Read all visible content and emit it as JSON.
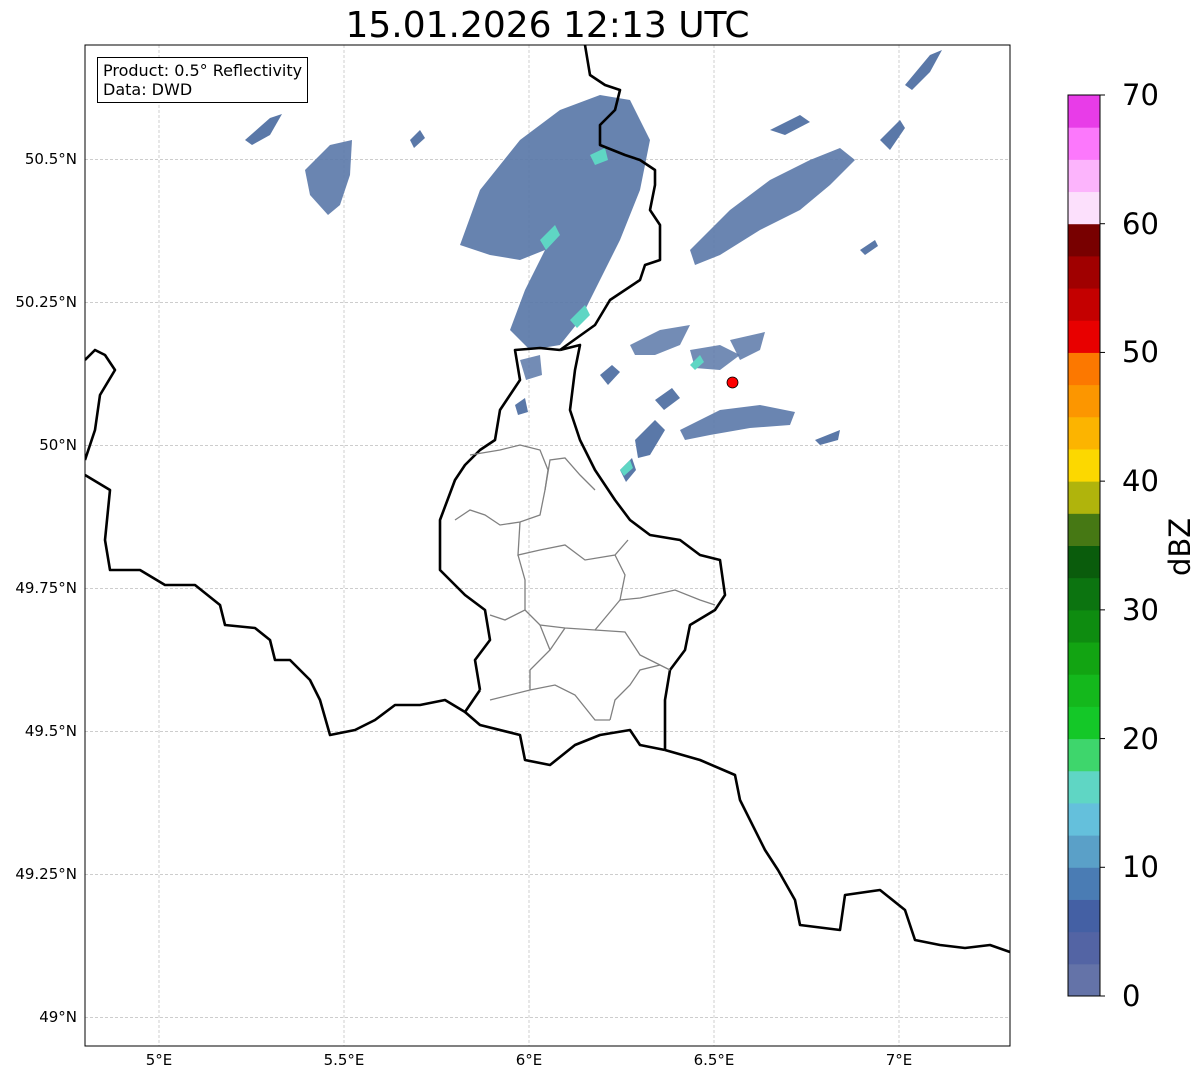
{
  "title": "15.01.2026 12:13 UTC",
  "info": {
    "product": "Product: 0.5° Reflectivity",
    "data": "Data: DWD"
  },
  "axes": {
    "lon_ticks": [
      {
        "value": 5.0,
        "label": "5°E"
      },
      {
        "value": 5.5,
        "label": "5.5°E"
      },
      {
        "value": 6.0,
        "label": "6°E"
      },
      {
        "value": 6.5,
        "label": "6.5°E"
      },
      {
        "value": 7.0,
        "label": "7°E"
      }
    ],
    "lat_ticks": [
      {
        "value": 50.5,
        "label": "50.5°N"
      },
      {
        "value": 50.25,
        "label": "50.25°N"
      },
      {
        "value": 50.0,
        "label": "50°N"
      },
      {
        "value": 49.75,
        "label": "49.75°N"
      },
      {
        "value": 49.5,
        "label": "49.5°N"
      },
      {
        "value": 49.25,
        "label": "49.25°N"
      },
      {
        "value": 49.0,
        "label": "49°N"
      }
    ],
    "lon_range": [
      4.8,
      7.3
    ],
    "lat_range": [
      48.95,
      50.7
    ],
    "grid": true
  },
  "colorbar": {
    "label": "dBZ",
    "min": 0,
    "max": 70,
    "step": 2.5,
    "ticks": [
      {
        "value": 0,
        "label": "0"
      },
      {
        "value": 10,
        "label": "10"
      },
      {
        "value": 20,
        "label": "20"
      },
      {
        "value": 30,
        "label": "30"
      },
      {
        "value": 40,
        "label": "40"
      },
      {
        "value": 50,
        "label": "50"
      },
      {
        "value": 60,
        "label": "60"
      },
      {
        "value": 70,
        "label": "70"
      }
    ],
    "colors": [
      "#6473a8",
      "#5364a4",
      "#4460a4",
      "#4a7cb4",
      "#5aa0c8",
      "#64c0dc",
      "#5fd6c4",
      "#3ed66c",
      "#14c828",
      "#14b81c",
      "#12a412",
      "#0e8c10",
      "#0c7410",
      "#0a5c0c",
      "#467814",
      "#b0b40c",
      "#fcd800",
      "#fcb400",
      "#fc9600",
      "#fc7800",
      "#e80000",
      "#c40000",
      "#a00000",
      "#780000",
      "#fce0fc",
      "#fcb4fc",
      "#fc78fc",
      "#e83ce8"
    ]
  },
  "radar_site": {
    "lon": 6.55,
    "lat": 50.11,
    "color": "#ff0000"
  },
  "echo_color": "#5a78a8",
  "highlight_color": "#5fd6c4"
}
